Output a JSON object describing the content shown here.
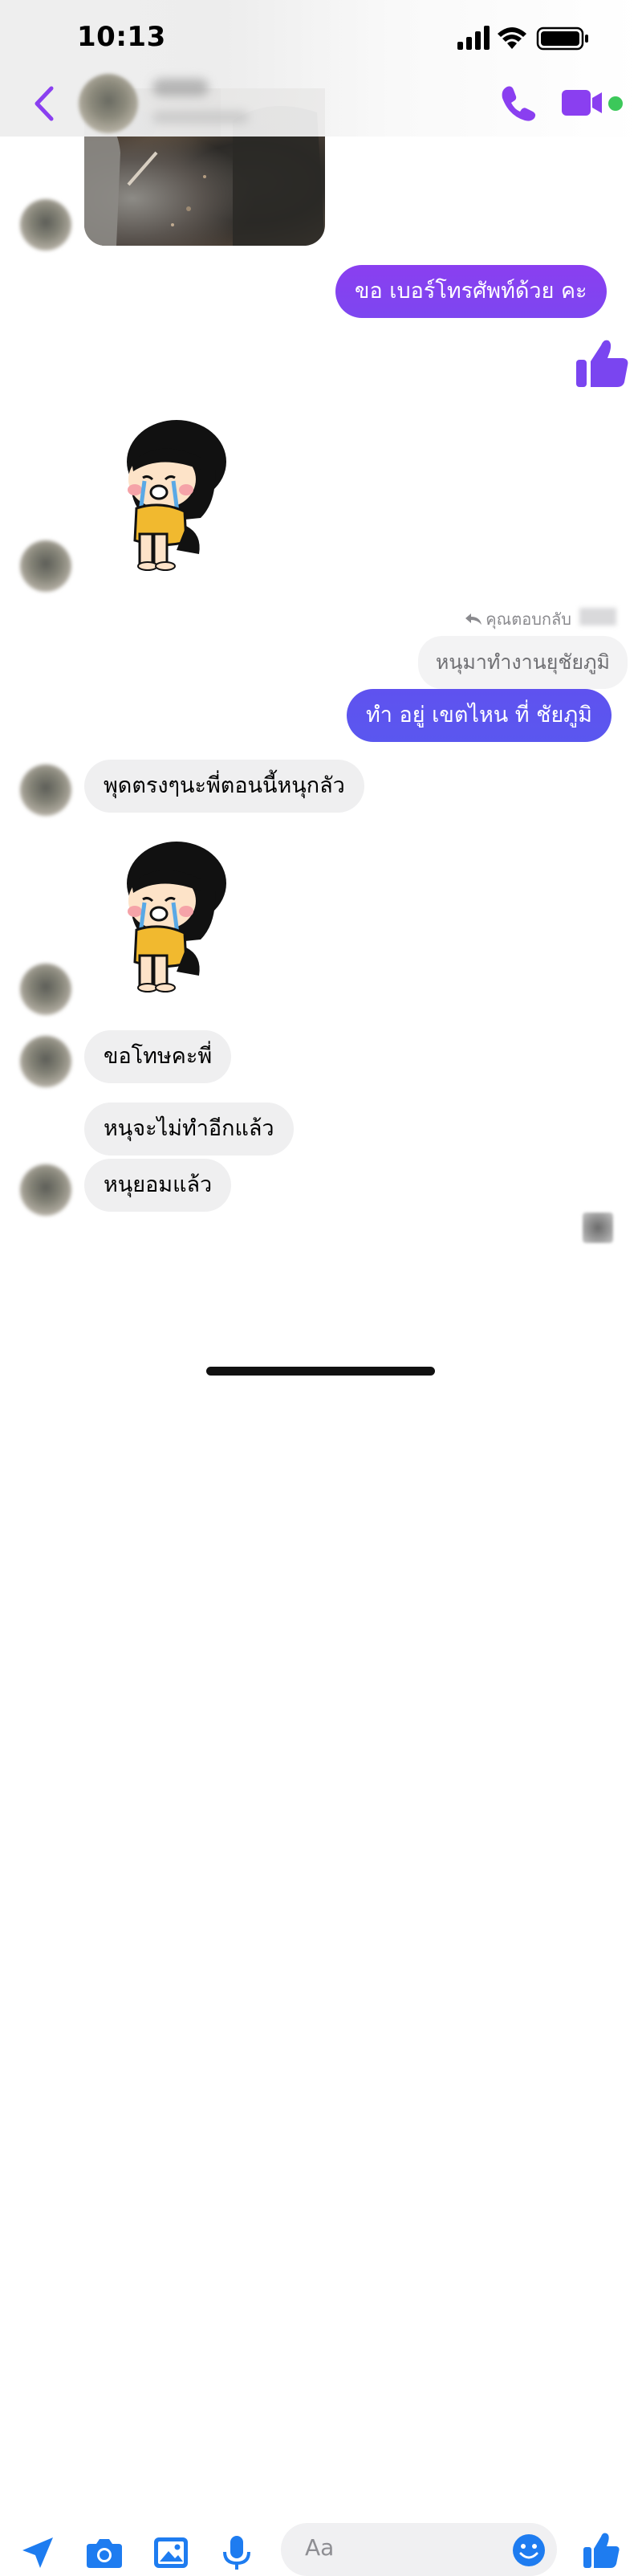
{
  "status_bar": {
    "time": "10:13"
  },
  "header": {
    "back_icon": "chevron-left-icon",
    "call_icon": "phone-icon",
    "video_icon": "video-camera-icon",
    "accent_color": "#8a3ff0",
    "active_color": "#3cc85a"
  },
  "messages": {
    "sent_1": "ขอ เบอร์โทรศัพท์ด้วย คะ",
    "reply_label": "คุณตอบกลับ",
    "quoted_text": "หนุมาทำงานยุชัยภูมิ",
    "sent_2": "ทำ อยู่ เขตไหน ที่ ชัยภูมิ",
    "recv_1": "พุดตรงๆนะพี่ตอนนี้หนุกลัว",
    "recv_2": "ขอโทษคะพี่",
    "recv_3": "หนุจะไม่ทำอีกแล้ว",
    "recv_4": "หนุยอมแล้ว"
  },
  "composer": {
    "placeholder": "Aa",
    "tools": [
      "location-icon",
      "camera-icon",
      "gallery-icon",
      "microphone-icon"
    ],
    "tool_color": "#1e7cf0"
  },
  "colors": {
    "sent_gradient_top": "#8a3ff0",
    "sent_gradient_bottom": "#5a57ef",
    "received_bubble": "#efeff0"
  }
}
